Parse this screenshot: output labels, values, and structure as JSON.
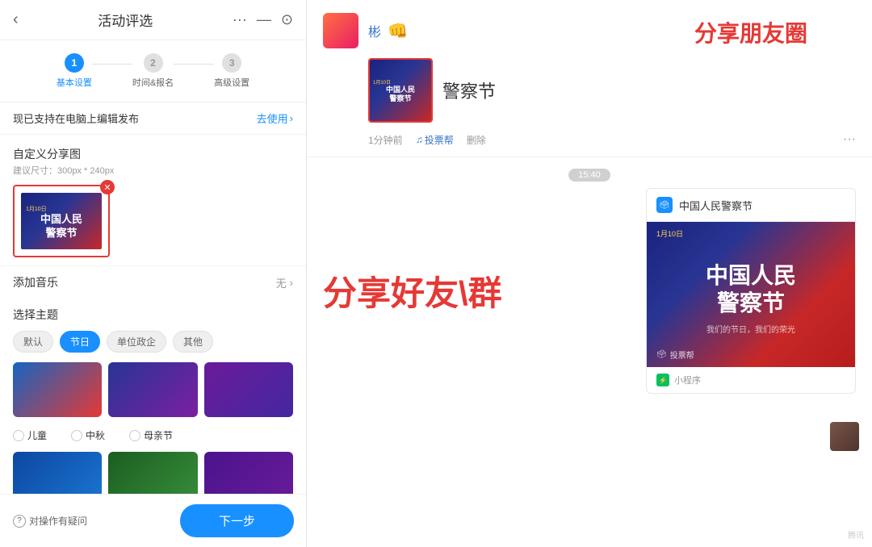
{
  "app": {
    "title": "活动评选"
  },
  "header": {
    "title": "活动评选",
    "more_icon": "···",
    "minimize_icon": "—",
    "close_icon": "⊙"
  },
  "steps": [
    {
      "number": "1",
      "label": "基本设置",
      "state": "active"
    },
    {
      "number": "2",
      "label": "时间&报名",
      "state": "inactive"
    },
    {
      "number": "3",
      "label": "高级设置",
      "state": "inactive"
    }
  ],
  "pc_banner": {
    "text": "现已支持在电脑上编辑发布",
    "link": "去使用"
  },
  "share_image": {
    "section_title": "自定义分享图",
    "hint": "建议尺寸：300px * 240px",
    "date_text": "1月10日",
    "title_line1": "中国人民",
    "title_line2": "警察节"
  },
  "music": {
    "label": "添加音乐",
    "value": "无"
  },
  "theme": {
    "label": "选择主题",
    "tags": [
      "默认",
      "节日",
      "单位政企",
      "其他"
    ],
    "active_tag": "节日",
    "radio_items": [
      "儿童",
      "中秋",
      "母亲节"
    ]
  },
  "footer": {
    "help_label": "对操作有疑问",
    "next_label": "下一步"
  },
  "right": {
    "share_circle_label": "分享朋友圈",
    "share_friend_label": "分享好友\\群",
    "username": "彬",
    "emoji": "👊",
    "post_title": "警察节",
    "post_date_text": "1月10日",
    "post_title_line1": "中国人民",
    "post_title_line2": "警察节",
    "time_ago": "1分钟前",
    "action_vote": "投票帮",
    "action_delete": "删除",
    "time_bubble": "15:40",
    "chat_card_title": "中国人民警察节",
    "chat_date": "1月10日",
    "chat_main_line1": "中国人民",
    "chat_main_line2": "警察节",
    "chat_sub": "我们的节日，我们的荣光",
    "chat_logo": "投票帮",
    "mini_label": "小程序",
    "bottom_label": "腾讯"
  }
}
